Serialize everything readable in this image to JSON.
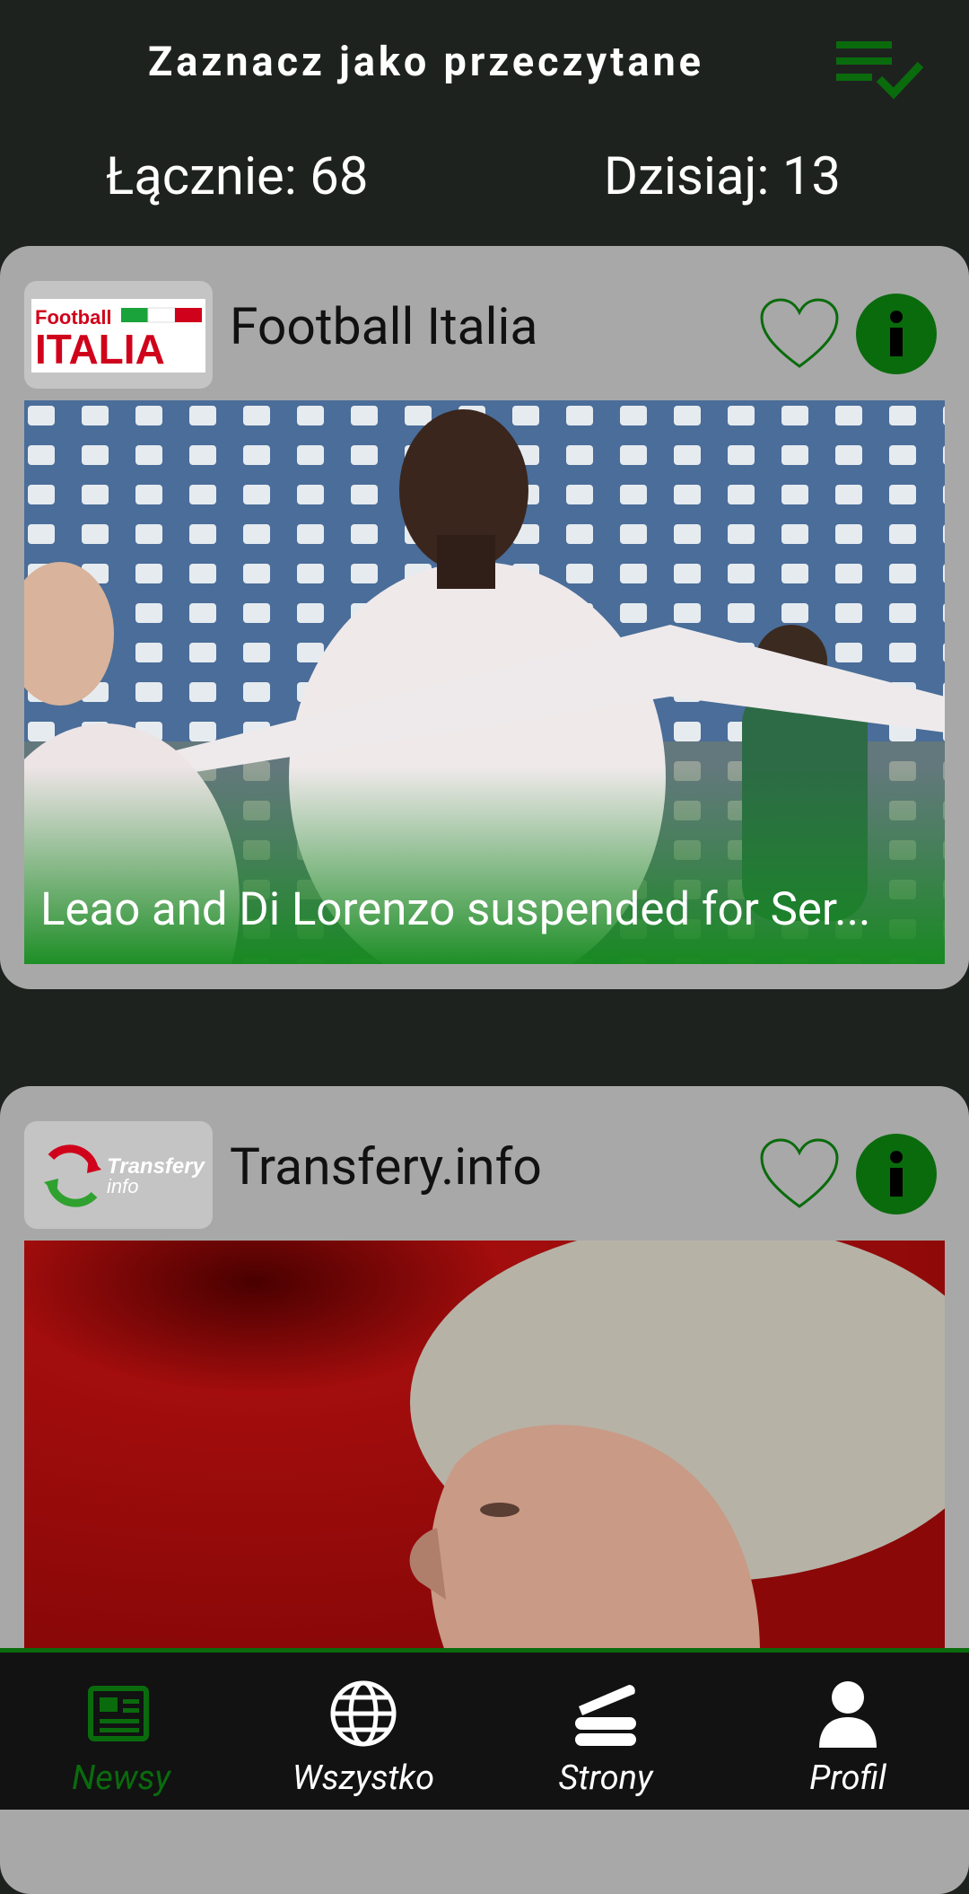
{
  "header": {
    "title": "Zaznacz jako przeczytane",
    "mark_read_icon": "playlist-check-icon"
  },
  "stats": {
    "total_label": "Łącznie: 68",
    "today_label": "Dzisiaj: 13"
  },
  "cards": [
    {
      "source_name": "Football Italia",
      "logo_text_top": "Football",
      "logo_text_main": "ITALIA",
      "headline": "Leao and Di Lorenzo suspended for Ser...",
      "favorite_icon": "heart-outline-icon",
      "info_icon": "info-icon"
    },
    {
      "source_name": "Transfery.info",
      "logo_text_top": "Transfery",
      "logo_text_sub": "info",
      "headline": "",
      "favorite_icon": "heart-outline-icon",
      "info_icon": "info-icon"
    }
  ],
  "nav": [
    {
      "label": "Newsy",
      "icon": "newspaper-icon",
      "active": true
    },
    {
      "label": "Wszystko",
      "icon": "globe-icon",
      "active": false
    },
    {
      "label": "Strony",
      "icon": "pages-stack-icon",
      "active": false
    },
    {
      "label": "Profil",
      "icon": "person-icon",
      "active": false
    }
  ],
  "colors": {
    "background": "#1e221f",
    "card": "#a8a8a8",
    "accent_green": "#0a6b0d",
    "nav_background": "#121212"
  }
}
